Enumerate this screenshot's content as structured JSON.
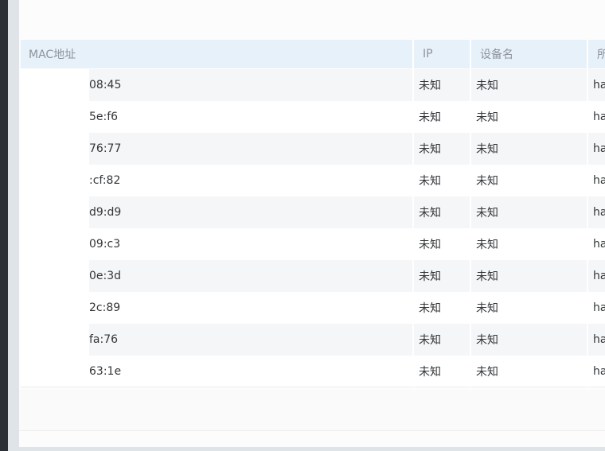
{
  "table": {
    "headers": {
      "mac": "MAC地址",
      "ip": "IP",
      "name": "设备名",
      "extra": "所"
    },
    "rows": [
      {
        "mac": "08:45",
        "ip": "未知",
        "name": "未知",
        "extra": "ha"
      },
      {
        "mac": "5e:f6",
        "ip": "未知",
        "name": "未知",
        "extra": "ha"
      },
      {
        "mac": "76:77",
        "ip": "未知",
        "name": "未知",
        "extra": "ha"
      },
      {
        "mac": ":cf:82",
        "ip": "未知",
        "name": "未知",
        "extra": "ha"
      },
      {
        "mac": "d9:d9",
        "ip": "未知",
        "name": "未知",
        "extra": "ha"
      },
      {
        "mac": "09:c3",
        "ip": "未知",
        "name": "未知",
        "extra": "ha"
      },
      {
        "mac": "0e:3d",
        "ip": "未知",
        "name": "未知",
        "extra": "ha"
      },
      {
        "mac": "2c:89",
        "ip": "未知",
        "name": "未知",
        "extra": "ha"
      },
      {
        "mac": "fa:76",
        "ip": "未知",
        "name": "未知",
        "extra": "ha"
      },
      {
        "mac": "63:1e",
        "ip": "未知",
        "name": "未知",
        "extra": "ha"
      }
    ]
  },
  "colors": {
    "header_bg": "#e6f1f9",
    "header_text": "#909399",
    "row_odd": "#f5f6f8",
    "row_even": "#ffffff",
    "left_rail": "#2b3037"
  }
}
